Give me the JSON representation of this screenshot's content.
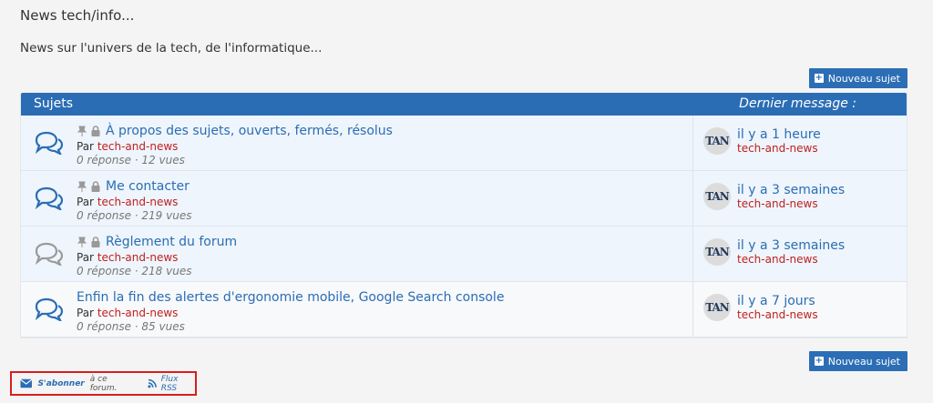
{
  "page": {
    "title": "News tech/info...",
    "description": "News sur l'univers de la tech, de l'informatique..."
  },
  "actions": {
    "new_topic": "Nouveau sujet"
  },
  "table": {
    "header_subjects": "Sujets",
    "header_last": "Dernier message :",
    "rows": [
      {
        "title": "À propos des sujets, ouverts, fermés, résolus",
        "by_prefix": "Par ",
        "author": "tech-and-news",
        "stats": "0 réponse · 12 vues",
        "last_time": "il y a 1 heure",
        "last_author": "tech-and-news",
        "pinned": true,
        "locked": true
      },
      {
        "title": "Me contacter",
        "by_prefix": "Par ",
        "author": "tech-and-news",
        "stats": "0 réponse · 219 vues",
        "last_time": "il y a 3 semaines",
        "last_author": "tech-and-news",
        "pinned": true,
        "locked": true
      },
      {
        "title": "Règlement du forum",
        "by_prefix": "Par ",
        "author": "tech-and-news",
        "stats": "0 réponse · 218 vues",
        "last_time": "il y a 3 semaines",
        "last_author": "tech-and-news",
        "pinned": true,
        "locked": true
      },
      {
        "title": "Enfin la fin des alertes d'ergonomie mobile, Google Search console",
        "by_prefix": "Par ",
        "author": "tech-and-news",
        "stats": "0 réponse · 85 vues",
        "last_time": "il y a 7 jours",
        "last_author": "tech-and-news",
        "pinned": false,
        "locked": false
      }
    ]
  },
  "footer": {
    "subscribe_link": "S'abonner",
    "subscribe_suffix": "à ce forum.",
    "rss": "Flux RSS"
  },
  "icons": {
    "topic": "chat-bubbles-icon",
    "pin": "pin-icon",
    "lock": "lock-icon",
    "mail": "envelope-icon",
    "rss": "rss-icon",
    "plus": "plus-icon"
  },
  "colors": {
    "accent": "#2b6db4",
    "author": "#c0201f",
    "highlight_border": "#d81e1e"
  }
}
